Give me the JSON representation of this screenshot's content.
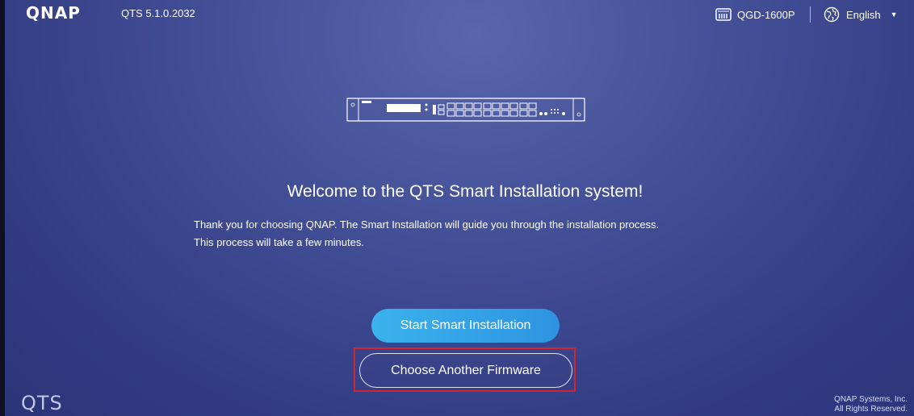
{
  "header": {
    "logo_text": "QNAP",
    "version": "QTS 5.1.0.2032",
    "device_model": "QGD-1600P",
    "language": "English",
    "icons": {
      "device": "nas-device-icon",
      "language": "globe-icon",
      "caret": "caret-down-icon"
    }
  },
  "main": {
    "welcome": "Welcome to the QTS Smart Installation system!",
    "description_line1": "Thank you for choosing QNAP. The Smart Installation will guide you through the installation process.",
    "description_line2": "This process will take a few minutes.",
    "start_button": "Start Smart Installation",
    "choose_firmware_button": "Choose Another Firmware"
  },
  "footer": {
    "brand_mark": "QTS",
    "copyright_line1": "QNAP Systems, Inc.",
    "copyright_line2": "All Rights Reserved."
  },
  "colors": {
    "background": "#3a4489",
    "accent": "#3bb2eb",
    "highlight": "#d0262f"
  }
}
